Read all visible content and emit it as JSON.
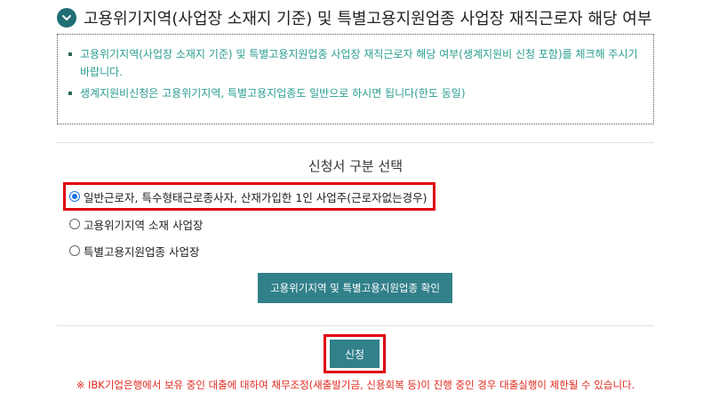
{
  "header": {
    "title": "고용위기지역(사업장 소재지 기준) 및 특별고용지원업종 사업장 재직근로자 해당 여부"
  },
  "notice": {
    "items": [
      "고용위기지역(사업장 소재지 기준) 및 특별고용지원업종 사업장 재직근로자 해당 여부(생계지원비 신청 포함)를 체크해 주시기 바랍니다.",
      "생계지원비신청은 고용위기지역, 특별고용지업종도 일반으로 하시면 됩니다(한도 동일)"
    ]
  },
  "section": {
    "title": "신청서 구분 선택"
  },
  "options": [
    {
      "label": "일반근로자, 특수형태근로종사자, 산재가입한 1인 사업주(근로자없는경우)",
      "selected": true
    },
    {
      "label": "고용위기지역 소재 사업장",
      "selected": false
    },
    {
      "label": "특별고용지원업종 사업장",
      "selected": false
    }
  ],
  "buttons": {
    "check_label": "고용위기지역 및 특별고용지원업종 확인",
    "apply_label": "신청"
  },
  "warning": "※ IBK기업은행에서 보유 중인 대출에 대하여 채무조정(새출발기금, 신용회복 등)이 진행 중인 경우 대출실행이 제한될 수 있습니다.",
  "colors": {
    "accent": "#31808a",
    "notice_text": "#2a9d8f",
    "highlight": "#e0000b",
    "warning": "#e0291e",
    "radio_checked": "#1a73e8"
  }
}
